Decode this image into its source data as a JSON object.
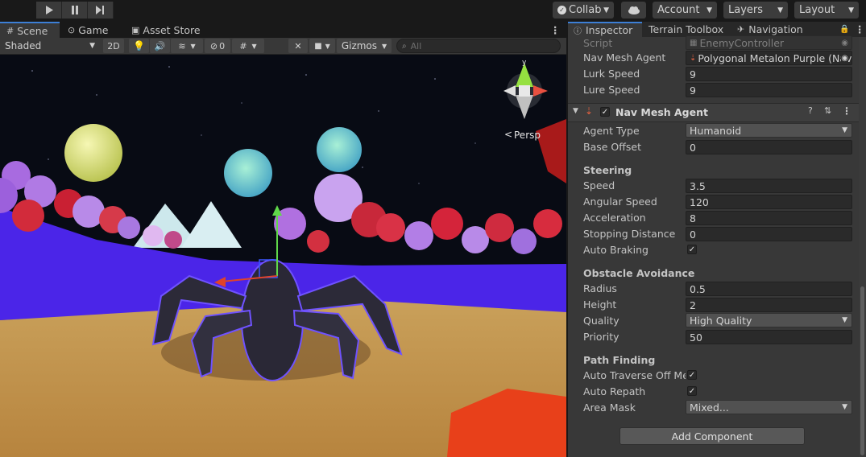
{
  "toolbar": {
    "collab_label": "Collab",
    "account_label": "Account",
    "layers_label": "Layers",
    "layout_label": "Layout"
  },
  "scene_panel": {
    "tabs": [
      {
        "label": "Scene"
      },
      {
        "label": "Game"
      },
      {
        "label": "Asset Store"
      }
    ],
    "shading_mode": "Shaded",
    "mode_2d_label": "2D",
    "hidden_count": "0",
    "gizmos_label": "Gizmos",
    "search_placeholder": "All",
    "projection_label": "Persp"
  },
  "inspector": {
    "tabs": [
      {
        "label": "Inspector"
      },
      {
        "label": "Terrain Toolbox"
      },
      {
        "label": "Navigation"
      }
    ],
    "script": {
      "label": "Script",
      "value": "EnemyController"
    },
    "fields": [
      {
        "label": "Nav Mesh Agent",
        "value": "Polygonal Metalon Purple (Nav"
      },
      {
        "label": "Lurk Speed",
        "value": "9"
      },
      {
        "label": "Lure Speed",
        "value": "9"
      }
    ],
    "component": {
      "title": "Nav Mesh Agent",
      "agent_type_label": "Agent Type",
      "agent_type_value": "Humanoid",
      "base_offset_label": "Base Offset",
      "base_offset_value": "0",
      "steering_title": "Steering",
      "speed_label": "Speed",
      "speed_value": "3.5",
      "angular_speed_label": "Angular Speed",
      "angular_speed_value": "120",
      "acceleration_label": "Acceleration",
      "acceleration_value": "8",
      "stopping_distance_label": "Stopping Distance",
      "stopping_distance_value": "0",
      "auto_braking_label": "Auto Braking",
      "auto_braking_checked": true,
      "obstacle_title": "Obstacle Avoidance",
      "radius_label": "Radius",
      "radius_value": "0.5",
      "height_label": "Height",
      "height_value": "2",
      "quality_label": "Quality",
      "quality_value": "High Quality",
      "priority_label": "Priority",
      "priority_value": "50",
      "pathfinding_title": "Path Finding",
      "auto_traverse_label": "Auto Traverse Off Mes",
      "auto_traverse_checked": true,
      "auto_repath_label": "Auto Repath",
      "auto_repath_checked": true,
      "area_mask_label": "Area Mask",
      "area_mask_value": "Mixed..."
    },
    "add_component_label": "Add Component"
  },
  "colors": {
    "accent": "#3d7fd6",
    "panel_bg": "#383838",
    "toolbar_bg": "#191919",
    "field_bg": "#2a2a2a"
  }
}
